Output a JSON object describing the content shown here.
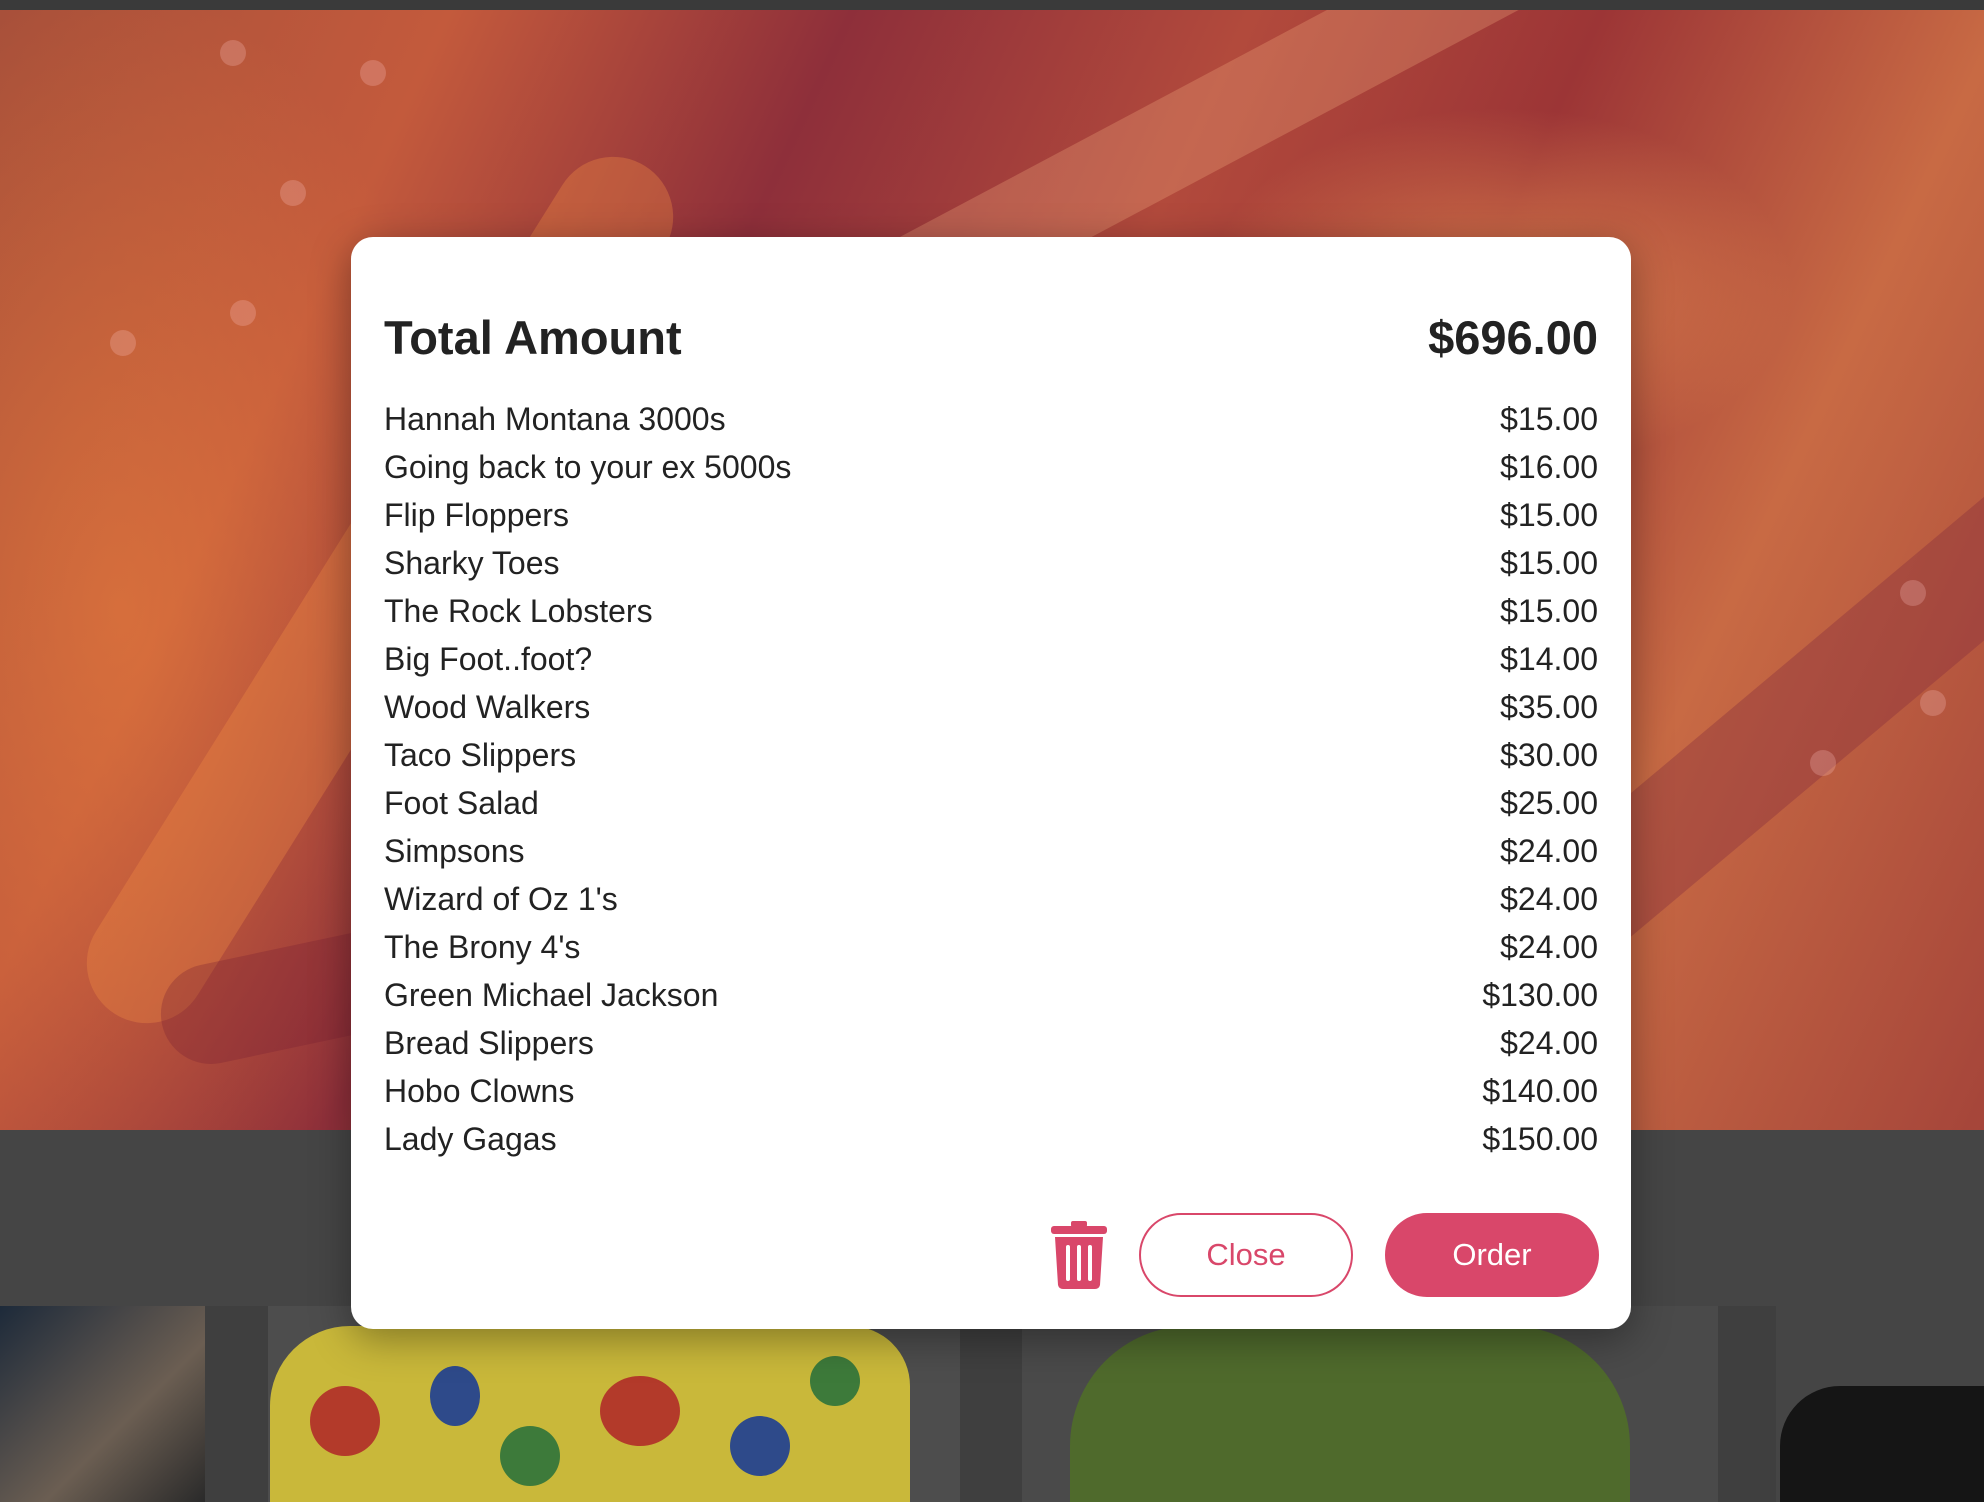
{
  "cart": {
    "title": "Total Amount",
    "total": "$696.00",
    "items": [
      {
        "name": "Hannah Montana 3000s",
        "price": "$15.00"
      },
      {
        "name": "Going back to your ex 5000s",
        "price": "$16.00"
      },
      {
        "name": "Flip Floppers",
        "price": "$15.00"
      },
      {
        "name": "Sharky Toes",
        "price": "$15.00"
      },
      {
        "name": "The Rock Lobsters",
        "price": "$15.00"
      },
      {
        "name": "Big Foot..foot?",
        "price": "$14.00"
      },
      {
        "name": "Wood Walkers",
        "price": "$35.00"
      },
      {
        "name": "Taco Slippers",
        "price": "$30.00"
      },
      {
        "name": "Foot Salad",
        "price": "$25.00"
      },
      {
        "name": "Simpsons",
        "price": "$24.00"
      },
      {
        "name": "Wizard of Oz 1's",
        "price": "$24.00"
      },
      {
        "name": "The Brony 4's",
        "price": "$24.00"
      },
      {
        "name": "Green Michael Jackson",
        "price": "$130.00"
      },
      {
        "name": "Bread Slippers",
        "price": "$24.00"
      },
      {
        "name": "Hobo Clowns",
        "price": "$140.00"
      },
      {
        "name": "Lady Gagas",
        "price": "$150.00"
      }
    ],
    "close_label": "Close",
    "order_label": "Order"
  },
  "icons": {
    "clear_cart": "trash-icon"
  },
  "colors": {
    "accent": "#d9476a",
    "text": "#222222",
    "modal_bg": "#ffffff"
  }
}
